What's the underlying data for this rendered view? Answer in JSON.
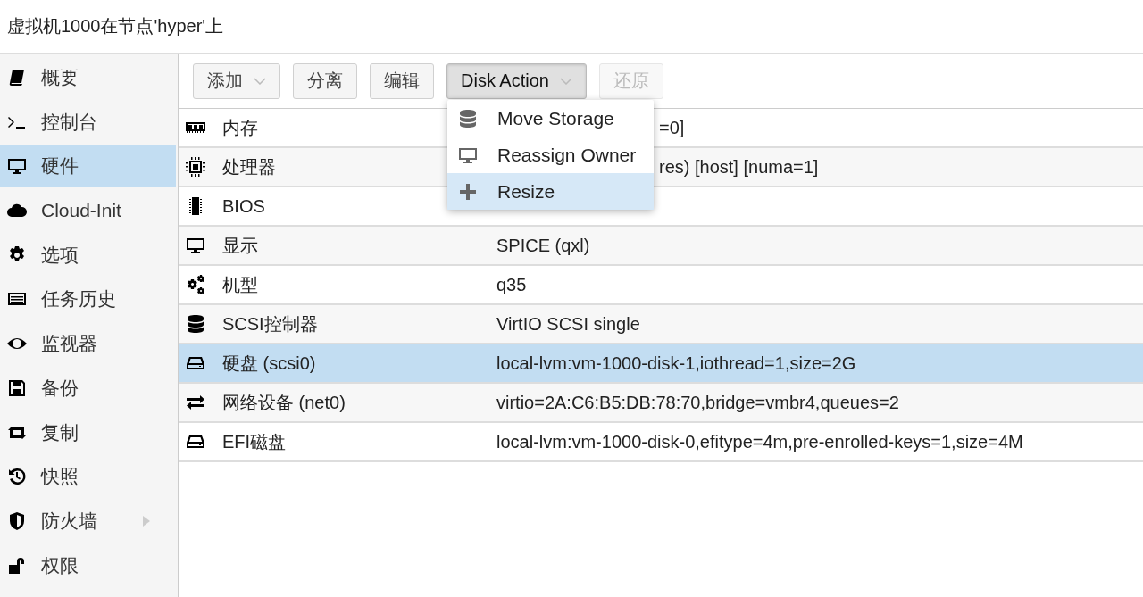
{
  "window": {
    "title": "虚拟机1000在节点'hyper'上"
  },
  "sidebar": {
    "items": [
      {
        "label": "概要",
        "kind": "item",
        "selected": false
      },
      {
        "label": "控制台",
        "kind": "item",
        "selected": false
      },
      {
        "label": "硬件",
        "kind": "item",
        "selected": true
      },
      {
        "label": "Cloud-Init",
        "kind": "item",
        "selected": false
      },
      {
        "label": "选项",
        "kind": "item",
        "selected": false
      },
      {
        "label": "任务历史",
        "kind": "item",
        "selected": false
      },
      {
        "label": "监视器",
        "kind": "item",
        "selected": false
      },
      {
        "label": "备份",
        "kind": "item",
        "selected": false
      },
      {
        "label": "复制",
        "kind": "item",
        "selected": false
      },
      {
        "label": "快照",
        "kind": "item",
        "selected": false
      },
      {
        "label": "防火墙",
        "kind": "group",
        "expanded": false,
        "selected": false
      },
      {
        "label": "权限",
        "kind": "item",
        "selected": false
      }
    ]
  },
  "toolbar": {
    "buttons": [
      {
        "label": "添加",
        "dropdown": true,
        "pressed": false,
        "disabled": false
      },
      {
        "label": "分离",
        "dropdown": false,
        "pressed": false,
        "disabled": false
      },
      {
        "label": "编辑",
        "dropdown": false,
        "pressed": false,
        "disabled": false
      },
      {
        "label": "Disk Action",
        "dropdown": true,
        "pressed": true,
        "disabled": false
      },
      {
        "label": "还原",
        "dropdown": false,
        "pressed": false,
        "disabled": true
      }
    ]
  },
  "menu": {
    "items": [
      {
        "label": "Move Storage",
        "selected": false
      },
      {
        "label": "Reassign Owner",
        "selected": false
      },
      {
        "label": "Resize",
        "selected": true
      }
    ]
  },
  "table": {
    "rows": [
      {
        "name": "内存",
        "value": "=0]",
        "covered": true,
        "selected": false
      },
      {
        "name": "处理器",
        "value": "res) [host] [numa=1]",
        "covered": true,
        "selected": false
      },
      {
        "name": "BIOS",
        "selected": false
      },
      {
        "name": "显示",
        "value": "SPICE (qxl)",
        "covered": false,
        "selected": false
      },
      {
        "name": "机型",
        "value": "q35",
        "covered": false,
        "selected": false
      },
      {
        "name": "SCSI控制器",
        "value": "VirtIO SCSI single",
        "covered": false,
        "selected": false
      },
      {
        "name": "硬盘 (scsi0)",
        "value": "local-lvm:vm-1000-disk-1,iothread=1,size=2G",
        "covered": false,
        "selected": true
      },
      {
        "name": "网络设备 (net0)",
        "value": "virtio=2A:C6:B5:DB:78:70,bridge=vmbr4,queues=2",
        "covered": false,
        "selected": false
      },
      {
        "name": "EFI磁盘",
        "value": "local-lvm:vm-1000-disk-0,efitype=4m,pre-enrolled-keys=1,size=4M",
        "covered": false,
        "selected": false
      }
    ]
  }
}
